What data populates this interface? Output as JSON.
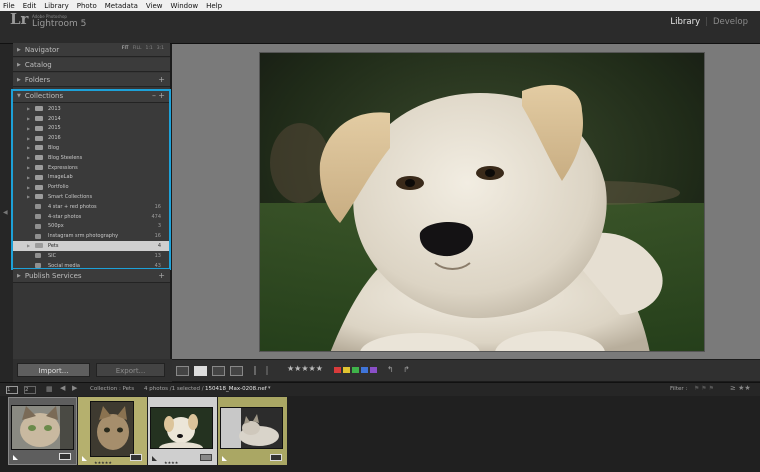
{
  "menu": [
    "File",
    "Edit",
    "Library",
    "Photo",
    "Metadata",
    "View",
    "Window",
    "Help"
  ],
  "app": {
    "logo": "Lr",
    "vendor": "Adobe Photoshop",
    "name": "Lightroom 5"
  },
  "modules": [
    {
      "label": "Library",
      "active": true
    },
    {
      "label": "Develop",
      "active": false
    }
  ],
  "panels": {
    "navigator": {
      "label": "Navigator",
      "opts": [
        "FIT",
        "FILL",
        "1:1",
        "3:1"
      ]
    },
    "catalog": {
      "label": "Catalog"
    },
    "folders": {
      "label": "Folders",
      "action": "+"
    },
    "collections": {
      "label": "Collections",
      "actions": [
        "–",
        "+"
      ]
    },
    "publish": {
      "label": "Publish Services",
      "action": "+"
    }
  },
  "collections": [
    {
      "name": "2013",
      "count": "",
      "type": "set",
      "expand": "▶"
    },
    {
      "name": "2014",
      "count": "",
      "type": "set",
      "expand": "▶"
    },
    {
      "name": "2015",
      "count": "",
      "type": "set",
      "expand": "▶"
    },
    {
      "name": "2016",
      "count": "",
      "type": "set",
      "expand": "▶"
    },
    {
      "name": "Blog",
      "count": "",
      "type": "set",
      "expand": "▶"
    },
    {
      "name": "Blog Steelens",
      "count": "",
      "type": "set",
      "expand": "▶"
    },
    {
      "name": "Expressions",
      "count": "",
      "type": "set",
      "expand": "▶"
    },
    {
      "name": "ImageLab",
      "count": "",
      "type": "set",
      "expand": "▶"
    },
    {
      "name": "Portfolio",
      "count": "",
      "type": "set",
      "expand": "▶"
    },
    {
      "name": "Smart Collections",
      "count": "",
      "type": "set",
      "expand": "▶"
    },
    {
      "name": "4 star + red photos",
      "count": "16",
      "type": "smart",
      "expand": ""
    },
    {
      "name": "4-star photos",
      "count": "474",
      "type": "smart",
      "expand": ""
    },
    {
      "name": "500px",
      "count": "3",
      "type": "smart",
      "expand": ""
    },
    {
      "name": "Instagram srm photography",
      "count": "16",
      "type": "smart",
      "expand": ""
    },
    {
      "name": "Pets",
      "count": "4",
      "type": "set",
      "expand": "▶",
      "selected": true
    },
    {
      "name": "SIC",
      "count": "13",
      "type": "smart",
      "expand": ""
    },
    {
      "name": "Social media",
      "count": "43",
      "type": "smart",
      "expand": ""
    }
  ],
  "buttons": {
    "import": "Import...",
    "export": "Export..."
  },
  "toolbar": {
    "stars": "★★★★★",
    "colors": [
      "#d83b3b",
      "#e0c431",
      "#3fb34a",
      "#3f74d8",
      "#8a4fc7"
    ]
  },
  "filmbar": {
    "pages": [
      "1",
      "2"
    ],
    "source": "Collection : Pets",
    "status": "4 photos /1 selected /",
    "filename": "150418_Max-0208.nef",
    "filter": "Filter :"
  },
  "thumbs": [
    {
      "subject": "cat",
      "bg": "#5e5e5e",
      "stars": ""
    },
    {
      "subject": "kitten",
      "bg": "#b5b06e",
      "stars": "★★★★★"
    },
    {
      "subject": "dog",
      "bg": "#cfcfcf",
      "stars": "★★★★"
    },
    {
      "subject": "cat-lying",
      "bg": "#aaa764",
      "stars": ""
    }
  ]
}
